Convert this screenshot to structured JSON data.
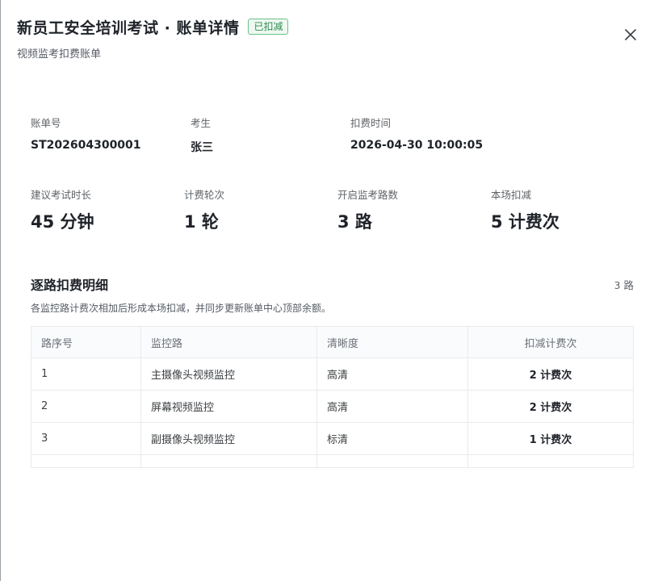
{
  "header": {
    "title": "新员工安全培训考试 · 账单详情",
    "badge": "已扣减",
    "subtitle": "视频监考扣费账单",
    "close_icon": "close-icon"
  },
  "info": {
    "row1": [
      {
        "label": "账单号",
        "value": "ST202604300001"
      },
      {
        "label": "考生",
        "value": "张三"
      },
      {
        "label": "扣费时间",
        "value": "2026-04-30 10:00:05"
      }
    ],
    "row2": [
      {
        "label": "建议考试时长",
        "value": "45 分钟"
      },
      {
        "label": "计费轮次",
        "value": "1 轮"
      },
      {
        "label": "开启监考路数",
        "value": "3 路"
      },
      {
        "label": "本场扣减",
        "value": "5 计费次"
      }
    ]
  },
  "section": {
    "title": "逐路扣费明细",
    "count": "3 路",
    "description": "各监控路计费次相加后形成本场扣减，并同步更新账单中心顶部余额。"
  },
  "table": {
    "headers": [
      "路序号",
      "监控路",
      "清晰度",
      "扣减计费次"
    ],
    "rows": [
      [
        "1",
        "主摄像头视频监控",
        "高清",
        "2 计费次"
      ],
      [
        "2",
        "屏幕视频监控",
        "高清",
        "2 计费次"
      ],
      [
        "3",
        "副摄像头视频监控",
        "标清",
        "1 计费次"
      ]
    ]
  },
  "colors": {
    "badge_text": "#2f8a4e",
    "badge_border": "#6cc08a",
    "badge_bg": "#eef9f1"
  }
}
